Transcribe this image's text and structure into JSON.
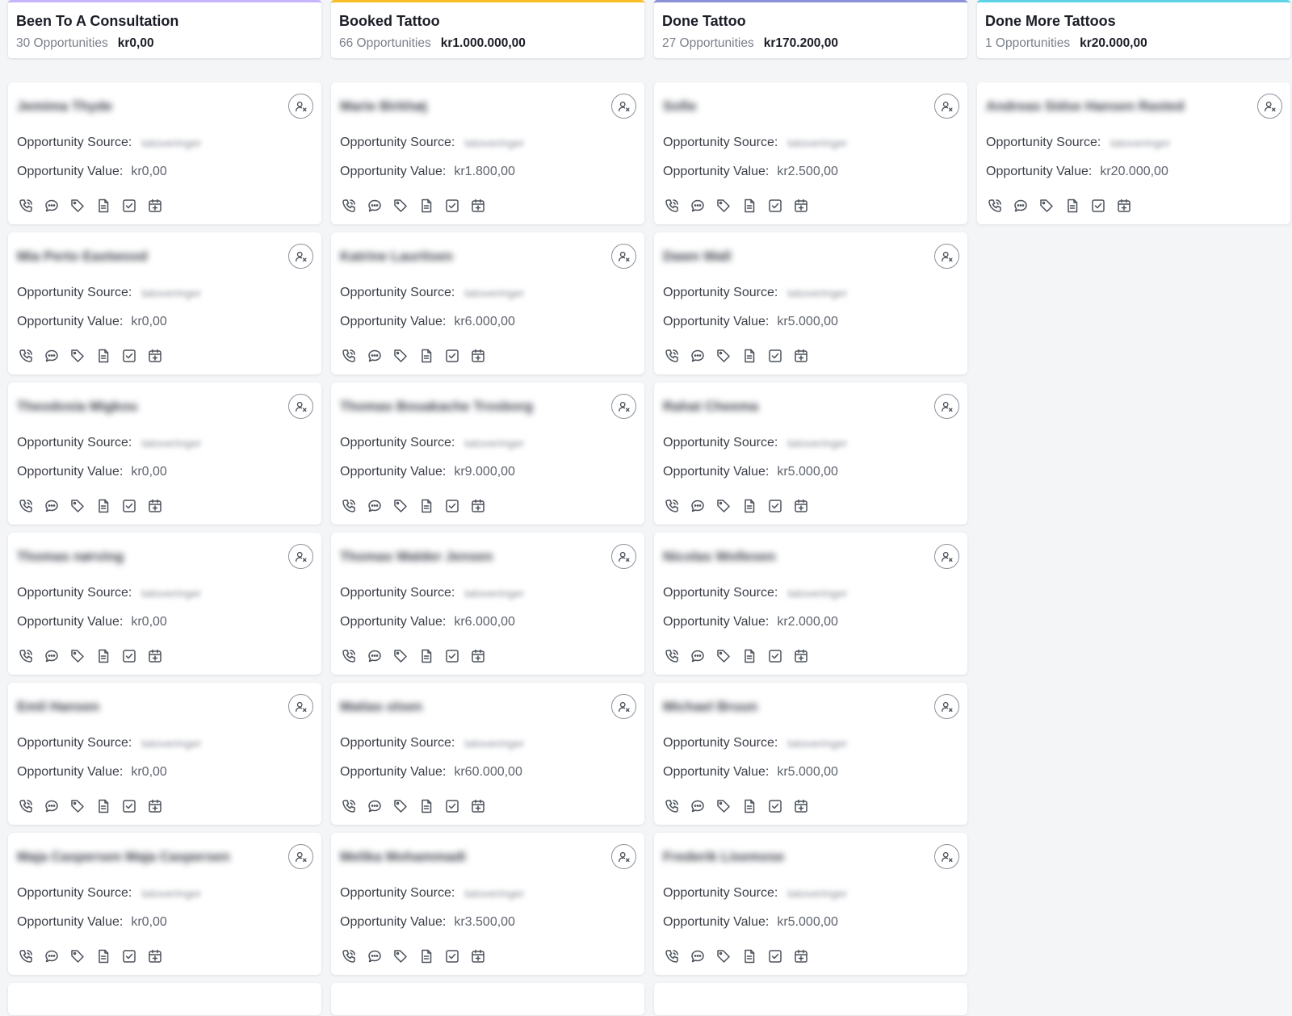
{
  "columns": [
    {
      "title": "Been To A Consultation",
      "count": "30 Opportunities",
      "amount": "kr0,00",
      "accent": "#c4b5fd",
      "cards": [
        {
          "name": "Jemima Thyde",
          "source_label": "Opportunity Source:",
          "source": "tatoveringer",
          "value_label": "Opportunity Value:",
          "value": "kr0,00"
        },
        {
          "name": "Mia Perto Eastwood",
          "source_label": "Opportunity Source:",
          "source": "tatoveringer",
          "value_label": "Opportunity Value:",
          "value": "kr0,00"
        },
        {
          "name": "Theodosia Migkou",
          "source_label": "Opportunity Source:",
          "source": "tatoveringer",
          "value_label": "Opportunity Value:",
          "value": "kr0,00"
        },
        {
          "name": "Thomas nørving",
          "source_label": "Opportunity Source:",
          "source": "tatoveringer",
          "value_label": "Opportunity Value:",
          "value": "kr0,00"
        },
        {
          "name": "Emil Hansen",
          "source_label": "Opportunity Source:",
          "source": "tatoveringer",
          "value_label": "Opportunity Value:",
          "value": "kr0,00"
        },
        {
          "name": "Maja Caspersen Maja Caspersen",
          "source_label": "Opportunity Source:",
          "source": "tatoveringer",
          "value_label": "Opportunity Value:",
          "value": "kr0,00"
        }
      ]
    },
    {
      "title": "Booked Tattoo",
      "count": "66 Opportunities",
      "amount": "kr1.000.000,00",
      "accent": "#fbbf24",
      "cards": [
        {
          "name": "Marie Birkhøj",
          "source_label": "Opportunity Source:",
          "source": "tatoveringer",
          "value_label": "Opportunity Value:",
          "value": "kr1.800,00"
        },
        {
          "name": "Katrine Lauritsen",
          "source_label": "Opportunity Source:",
          "source": "tatoveringer",
          "value_label": "Opportunity Value:",
          "value": "kr6.000,00"
        },
        {
          "name": "Thomas Bouakache Trosborg",
          "source_label": "Opportunity Source:",
          "source": "tatoveringer",
          "value_label": "Opportunity Value:",
          "value": "kr9.000,00"
        },
        {
          "name": "Thomas Walder Jensen",
          "source_label": "Opportunity Source:",
          "source": "tatoveringer",
          "value_label": "Opportunity Value:",
          "value": "kr6.000,00"
        },
        {
          "name": "Matias olsen",
          "source_label": "Opportunity Source:",
          "source": "tatoveringer",
          "value_label": "Opportunity Value:",
          "value": "kr60.000,00"
        },
        {
          "name": "Melika Mohammadi",
          "source_label": "Opportunity Source:",
          "source": "tatoveringer",
          "value_label": "Opportunity Value:",
          "value": "kr3.500,00"
        }
      ]
    },
    {
      "title": "Done Tattoo",
      "count": "27 Opportunities",
      "amount": "kr170.200,00",
      "accent": "#8b8fd6",
      "cards": [
        {
          "name": "Sofie",
          "source_label": "Opportunity Source:",
          "source": "tatoveringer",
          "value_label": "Opportunity Value:",
          "value": "kr2.500,00"
        },
        {
          "name": "Dawn Wall",
          "source_label": "Opportunity Source:",
          "source": "tatoveringer",
          "value_label": "Opportunity Value:",
          "value": "kr5.000,00"
        },
        {
          "name": "Rahat Cheema",
          "source_label": "Opportunity Source:",
          "source": "tatoveringer",
          "value_label": "Opportunity Value:",
          "value": "kr5.000,00"
        },
        {
          "name": "Nicolas Wollesen",
          "source_label": "Opportunity Source:",
          "source": "tatoveringer",
          "value_label": "Opportunity Value:",
          "value": "kr2.000,00"
        },
        {
          "name": "Michael Bruun",
          "source_label": "Opportunity Source:",
          "source": "tatoveringer",
          "value_label": "Opportunity Value:",
          "value": "kr5.000,00"
        },
        {
          "name": "Frederik Lisemose",
          "source_label": "Opportunity Source:",
          "source": "tatoveringer",
          "value_label": "Opportunity Value:",
          "value": "kr5.000,00"
        }
      ]
    },
    {
      "title": "Done More Tattoos",
      "count": "1 Opportunities",
      "amount": "kr20.000,00",
      "accent": "#5ed4e6",
      "cards": [
        {
          "name": "Andreas Sidse Hansen Rasted",
          "source_label": "Opportunity Source:",
          "source": "tatoveringer",
          "value_label": "Opportunity Value:",
          "value": "kr20.000,00"
        }
      ]
    }
  ],
  "card_actions": [
    "phone-icon",
    "message-icon",
    "tag-icon",
    "document-icon",
    "task-checkbox-icon",
    "calendar-add-icon"
  ]
}
